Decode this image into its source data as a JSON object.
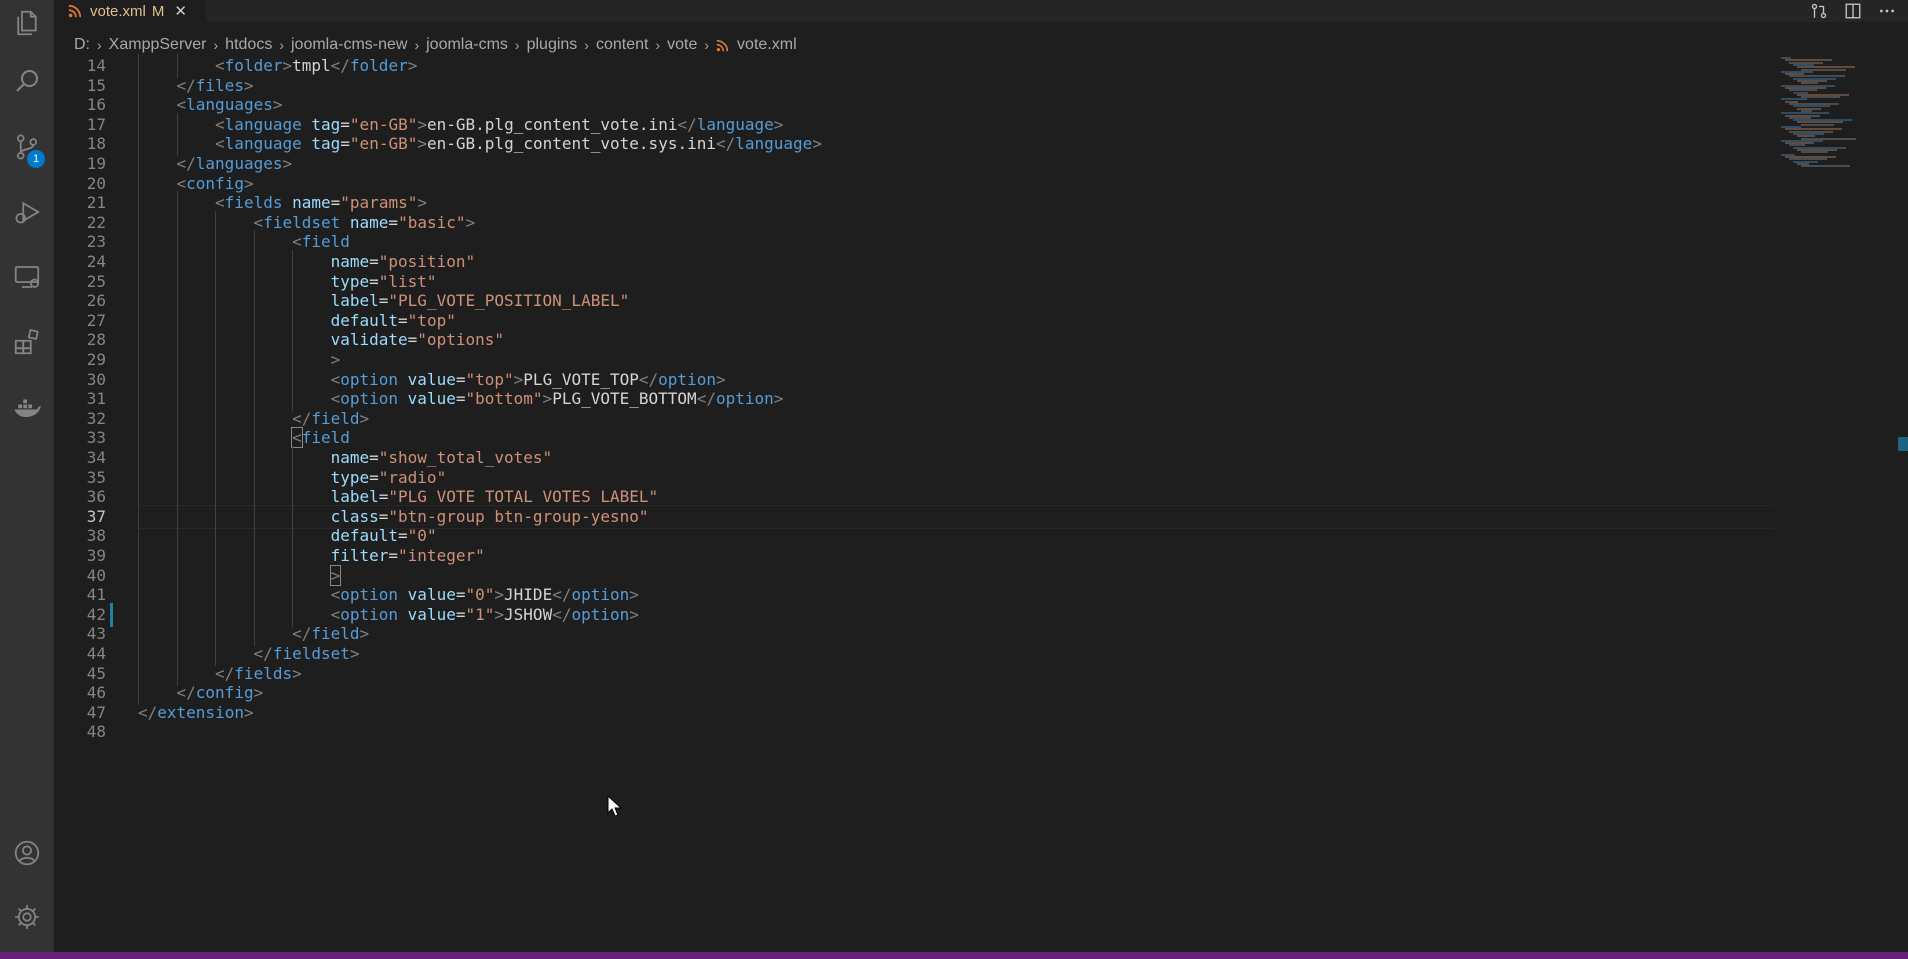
{
  "tab": {
    "filename": "vote.xml",
    "modified_marker": "M",
    "close_glyph": "✕",
    "icon": "rss-file-icon"
  },
  "breadcrumb": [
    "D:",
    "XamppServer",
    "htdocs",
    "joomla-cms-new",
    "joomla-cms",
    "plugins",
    "content",
    "vote",
    "vote.xml"
  ],
  "activity_bar": {
    "items": [
      "explorer-icon",
      "search-icon",
      "source-control-icon",
      "run-debug-icon",
      "remote-explorer-icon",
      "extensions-icon",
      "docker-icon"
    ],
    "bottom_items": [
      "accounts-icon",
      "manage-gear-icon"
    ],
    "source_control_badge": "1"
  },
  "editor_actions": [
    "open-changes-icon",
    "split-editor-icon",
    "more-actions-icon"
  ],
  "current_line": 37,
  "lines": [
    {
      "n": "14",
      "indent": 2,
      "toks": [
        [
          "p",
          "<"
        ],
        [
          "t",
          "folder"
        ],
        [
          "p",
          ">"
        ],
        [
          "x",
          "tmpl"
        ],
        [
          "p",
          "</"
        ],
        [
          "t",
          "folder"
        ],
        [
          "p",
          ">"
        ]
      ]
    },
    {
      "n": "15",
      "indent": 1,
      "toks": [
        [
          "p",
          "</"
        ],
        [
          "t",
          "files"
        ],
        [
          "p",
          ">"
        ]
      ]
    },
    {
      "n": "16",
      "indent": 1,
      "toks": [
        [
          "p",
          "<"
        ],
        [
          "t",
          "languages"
        ],
        [
          "p",
          ">"
        ]
      ]
    },
    {
      "n": "17",
      "indent": 2,
      "toks": [
        [
          "p",
          "<"
        ],
        [
          "t",
          "language"
        ],
        [
          "x",
          " "
        ],
        [
          "a",
          "tag"
        ],
        [
          "x",
          "="
        ],
        [
          "s",
          "\"en-GB\""
        ],
        [
          "p",
          ">"
        ],
        [
          "x",
          "en-GB.plg_content_vote.ini"
        ],
        [
          "p",
          "</"
        ],
        [
          "t",
          "language"
        ],
        [
          "p",
          ">"
        ]
      ]
    },
    {
      "n": "18",
      "indent": 2,
      "toks": [
        [
          "p",
          "<"
        ],
        [
          "t",
          "language"
        ],
        [
          "x",
          " "
        ],
        [
          "a",
          "tag"
        ],
        [
          "x",
          "="
        ],
        [
          "s",
          "\"en-GB\""
        ],
        [
          "p",
          ">"
        ],
        [
          "x",
          "en-GB.plg_content_vote.sys.ini"
        ],
        [
          "p",
          "</"
        ],
        [
          "t",
          "language"
        ],
        [
          "p",
          ">"
        ]
      ]
    },
    {
      "n": "19",
      "indent": 1,
      "toks": [
        [
          "p",
          "</"
        ],
        [
          "t",
          "languages"
        ],
        [
          "p",
          ">"
        ]
      ]
    },
    {
      "n": "20",
      "indent": 1,
      "toks": [
        [
          "p",
          "<"
        ],
        [
          "t",
          "config"
        ],
        [
          "p",
          ">"
        ]
      ]
    },
    {
      "n": "21",
      "indent": 2,
      "toks": [
        [
          "p",
          "<"
        ],
        [
          "t",
          "fields"
        ],
        [
          "x",
          " "
        ],
        [
          "a",
          "name"
        ],
        [
          "x",
          "="
        ],
        [
          "s",
          "\"params\""
        ],
        [
          "p",
          ">"
        ]
      ]
    },
    {
      "n": "22",
      "indent": 3,
      "toks": [
        [
          "p",
          "<"
        ],
        [
          "t",
          "fieldset"
        ],
        [
          "x",
          " "
        ],
        [
          "a",
          "name"
        ],
        [
          "x",
          "="
        ],
        [
          "s",
          "\"basic\""
        ],
        [
          "p",
          ">"
        ]
      ]
    },
    {
      "n": "23",
      "indent": 4,
      "toks": [
        [
          "p",
          "<"
        ],
        [
          "t",
          "field"
        ]
      ]
    },
    {
      "n": "24",
      "indent": 5,
      "toks": [
        [
          "a",
          "name"
        ],
        [
          "x",
          "="
        ],
        [
          "s",
          "\"position\""
        ]
      ]
    },
    {
      "n": "25",
      "indent": 5,
      "toks": [
        [
          "a",
          "type"
        ],
        [
          "x",
          "="
        ],
        [
          "s",
          "\"list\""
        ]
      ]
    },
    {
      "n": "26",
      "indent": 5,
      "toks": [
        [
          "a",
          "label"
        ],
        [
          "x",
          "="
        ],
        [
          "s",
          "\"PLG_VOTE_POSITION_LABEL\""
        ]
      ]
    },
    {
      "n": "27",
      "indent": 5,
      "toks": [
        [
          "a",
          "default"
        ],
        [
          "x",
          "="
        ],
        [
          "s",
          "\"top\""
        ]
      ]
    },
    {
      "n": "28",
      "indent": 5,
      "toks": [
        [
          "a",
          "validate"
        ],
        [
          "x",
          "="
        ],
        [
          "s",
          "\"options\""
        ]
      ]
    },
    {
      "n": "29",
      "indent": 5,
      "toks": [
        [
          "p",
          ">"
        ]
      ]
    },
    {
      "n": "30",
      "indent": 5,
      "toks": [
        [
          "p",
          "<"
        ],
        [
          "t",
          "option"
        ],
        [
          "x",
          " "
        ],
        [
          "a",
          "value"
        ],
        [
          "x",
          "="
        ],
        [
          "s",
          "\"top\""
        ],
        [
          "p",
          ">"
        ],
        [
          "x",
          "PLG_VOTE_TOP"
        ],
        [
          "p",
          "</"
        ],
        [
          "t",
          "option"
        ],
        [
          "p",
          ">"
        ]
      ]
    },
    {
      "n": "31",
      "indent": 5,
      "toks": [
        [
          "p",
          "<"
        ],
        [
          "t",
          "option"
        ],
        [
          "x",
          " "
        ],
        [
          "a",
          "value"
        ],
        [
          "x",
          "="
        ],
        [
          "s",
          "\"bottom\""
        ],
        [
          "p",
          ">"
        ],
        [
          "x",
          "PLG_VOTE_BOTTOM"
        ],
        [
          "p",
          "</"
        ],
        [
          "t",
          "option"
        ],
        [
          "p",
          ">"
        ]
      ]
    },
    {
      "n": "32",
      "indent": 4,
      "toks": [
        [
          "p",
          "</"
        ],
        [
          "t",
          "field"
        ],
        [
          "p",
          ">"
        ]
      ]
    },
    {
      "n": "33",
      "indent": 4,
      "toks": [
        [
          "pb",
          "<"
        ],
        [
          "t",
          "field"
        ]
      ]
    },
    {
      "n": "34",
      "indent": 5,
      "toks": [
        [
          "a",
          "name"
        ],
        [
          "x",
          "="
        ],
        [
          "s",
          "\"show_total_votes\""
        ]
      ]
    },
    {
      "n": "35",
      "indent": 5,
      "toks": [
        [
          "a",
          "type"
        ],
        [
          "x",
          "="
        ],
        [
          "s",
          "\"radio\""
        ]
      ]
    },
    {
      "n": "36",
      "indent": 5,
      "toks": [
        [
          "a",
          "label"
        ],
        [
          "x",
          "="
        ],
        [
          "s",
          "\"PLG_VOTE_TOTAL_VOTES_LABEL\""
        ]
      ]
    },
    {
      "n": "37",
      "indent": 5,
      "toks": [
        [
          "a",
          "class"
        ],
        [
          "x",
          "="
        ],
        [
          "s",
          "\"btn-group btn-group-yesno\""
        ]
      ]
    },
    {
      "n": "38",
      "indent": 5,
      "toks": [
        [
          "a",
          "default"
        ],
        [
          "x",
          "="
        ],
        [
          "s",
          "\"0\""
        ]
      ]
    },
    {
      "n": "39",
      "indent": 5,
      "toks": [
        [
          "a",
          "filter"
        ],
        [
          "x",
          "="
        ],
        [
          "s",
          "\"integer\""
        ]
      ]
    },
    {
      "n": "40",
      "indent": 5,
      "toks": [
        [
          "pb",
          ">"
        ]
      ]
    },
    {
      "n": "41",
      "indent": 5,
      "toks": [
        [
          "p",
          "<"
        ],
        [
          "t",
          "option"
        ],
        [
          "x",
          " "
        ],
        [
          "a",
          "value"
        ],
        [
          "x",
          "="
        ],
        [
          "s",
          "\"0\""
        ],
        [
          "p",
          ">"
        ],
        [
          "x",
          "JHIDE"
        ],
        [
          "p",
          "</"
        ],
        [
          "t",
          "option"
        ],
        [
          "p",
          ">"
        ]
      ]
    },
    {
      "n": "42",
      "indent": 5,
      "toks": [
        [
          "p",
          "<"
        ],
        [
          "t",
          "option"
        ],
        [
          "x",
          " "
        ],
        [
          "a",
          "value"
        ],
        [
          "x",
          "="
        ],
        [
          "s",
          "\"1\""
        ],
        [
          "p",
          ">"
        ],
        [
          "x",
          "JSHOW"
        ],
        [
          "p",
          "</"
        ],
        [
          "t",
          "option"
        ],
        [
          "p",
          ">"
        ]
      ]
    },
    {
      "n": "43",
      "indent": 4,
      "toks": [
        [
          "p",
          "</"
        ],
        [
          "t",
          "field"
        ],
        [
          "p",
          ">"
        ]
      ]
    },
    {
      "n": "44",
      "indent": 3,
      "toks": [
        [
          "p",
          "</"
        ],
        [
          "t",
          "fieldset"
        ],
        [
          "p",
          ">"
        ]
      ]
    },
    {
      "n": "45",
      "indent": 2,
      "toks": [
        [
          "p",
          "</"
        ],
        [
          "t",
          "fields"
        ],
        [
          "p",
          ">"
        ]
      ]
    },
    {
      "n": "46",
      "indent": 1,
      "toks": [
        [
          "p",
          "</"
        ],
        [
          "t",
          "config"
        ],
        [
          "p",
          ">"
        ]
      ]
    },
    {
      "n": "47",
      "indent": 0,
      "toks": [
        [
          "p",
          "</"
        ],
        [
          "t",
          "extension"
        ],
        [
          "p",
          ">"
        ]
      ]
    },
    {
      "n": "48",
      "indent": 0,
      "toks": []
    }
  ],
  "colors": {
    "tag": "#569cd6",
    "attribute": "#9cdcfe",
    "string": "#ce9178",
    "punctuation": "#808080",
    "text": "#d4d4d4",
    "modified_tab": "#e2c08d",
    "status_bar": "#68217a",
    "accent": "#007acc"
  }
}
